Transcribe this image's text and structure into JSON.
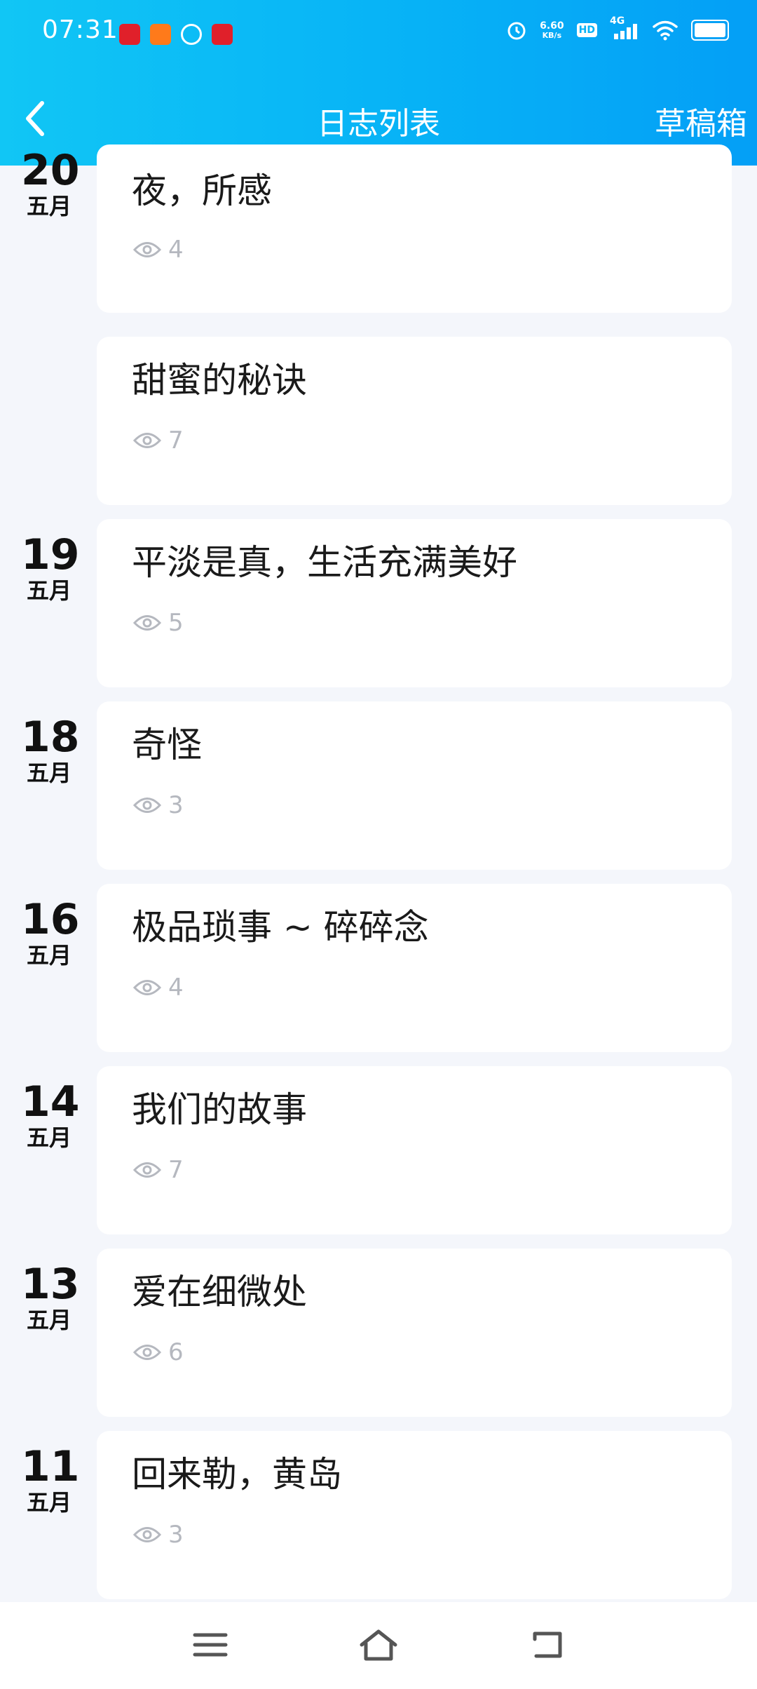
{
  "status_bar": {
    "time": "07:31",
    "net_speed_value": "6.60",
    "net_speed_unit": "KB/s",
    "hd": "HD",
    "network": "4G"
  },
  "app_bar": {
    "title": "日志列表",
    "drafts_label": "草稿箱"
  },
  "entries": [
    {
      "day": "20",
      "month": "五月",
      "title": "夜，所感",
      "views": "4"
    },
    {
      "day": "",
      "month": "",
      "title": "甜蜜的秘诀",
      "views": "7"
    },
    {
      "day": "19",
      "month": "五月",
      "title": "平淡是真，生活充满美好",
      "views": "5"
    },
    {
      "day": "18",
      "month": "五月",
      "title": "奇怪",
      "views": "3"
    },
    {
      "day": "16",
      "month": "五月",
      "title": "极品琐事 ~ 碎碎念",
      "views": "4"
    },
    {
      "day": "14",
      "month": "五月",
      "title": "我们的故事",
      "views": "7"
    },
    {
      "day": "13",
      "month": "五月",
      "title": "爱在细微处",
      "views": "6"
    },
    {
      "day": "11",
      "month": "五月",
      "title": "回来勒，黄岛",
      "views": "3"
    }
  ],
  "icons": {
    "back": "chevron-left-icon",
    "views": "eye-icon",
    "nav_menu": "menu-icon",
    "nav_home": "home-icon",
    "nav_back": "return-icon"
  },
  "colors": {
    "header_start": "#11c6f5",
    "header_end": "#049ff6",
    "background": "#f4f6fb",
    "card": "#ffffff",
    "muted": "#b5b8bf"
  }
}
